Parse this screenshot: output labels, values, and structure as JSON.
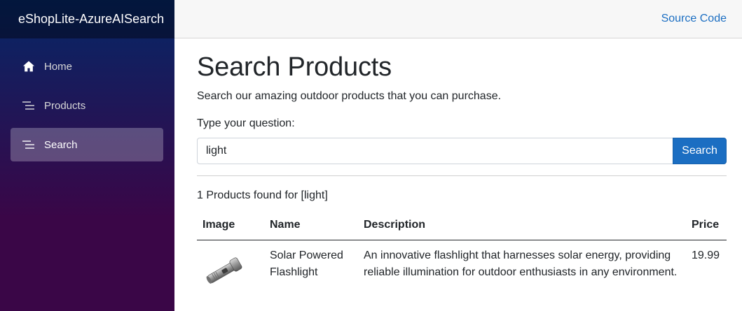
{
  "app": {
    "brand": "eShopLite-AzureAISearch"
  },
  "header": {
    "source_code_label": "Source Code"
  },
  "sidebar": {
    "items": [
      {
        "label": "Home",
        "icon": "home-icon",
        "active": false
      },
      {
        "label": "Products",
        "icon": "list-icon",
        "active": false
      },
      {
        "label": "Search",
        "icon": "list-icon",
        "active": true
      }
    ]
  },
  "main": {
    "title": "Search Products",
    "subtitle": "Search our amazing outdoor products that you can purchase.",
    "question_label": "Type your question:",
    "search": {
      "value": "light",
      "button_label": "Search"
    },
    "results_text": "1 Products found for [light]",
    "table": {
      "headers": [
        "Image",
        "Name",
        "Description",
        "Price"
      ],
      "rows": [
        {
          "image": "flashlight-image",
          "name": "Solar Powered Flashlight",
          "description": "An innovative flashlight that harnesses solar energy, providing reliable illumination for outdoor enthusiasts in any environment.",
          "price": "19.99"
        }
      ]
    }
  },
  "colors": {
    "accent": "#1b6ec2",
    "sidebar_top": "#052767",
    "sidebar_bottom": "#3a0647",
    "topbar": "#f7f7f7"
  }
}
